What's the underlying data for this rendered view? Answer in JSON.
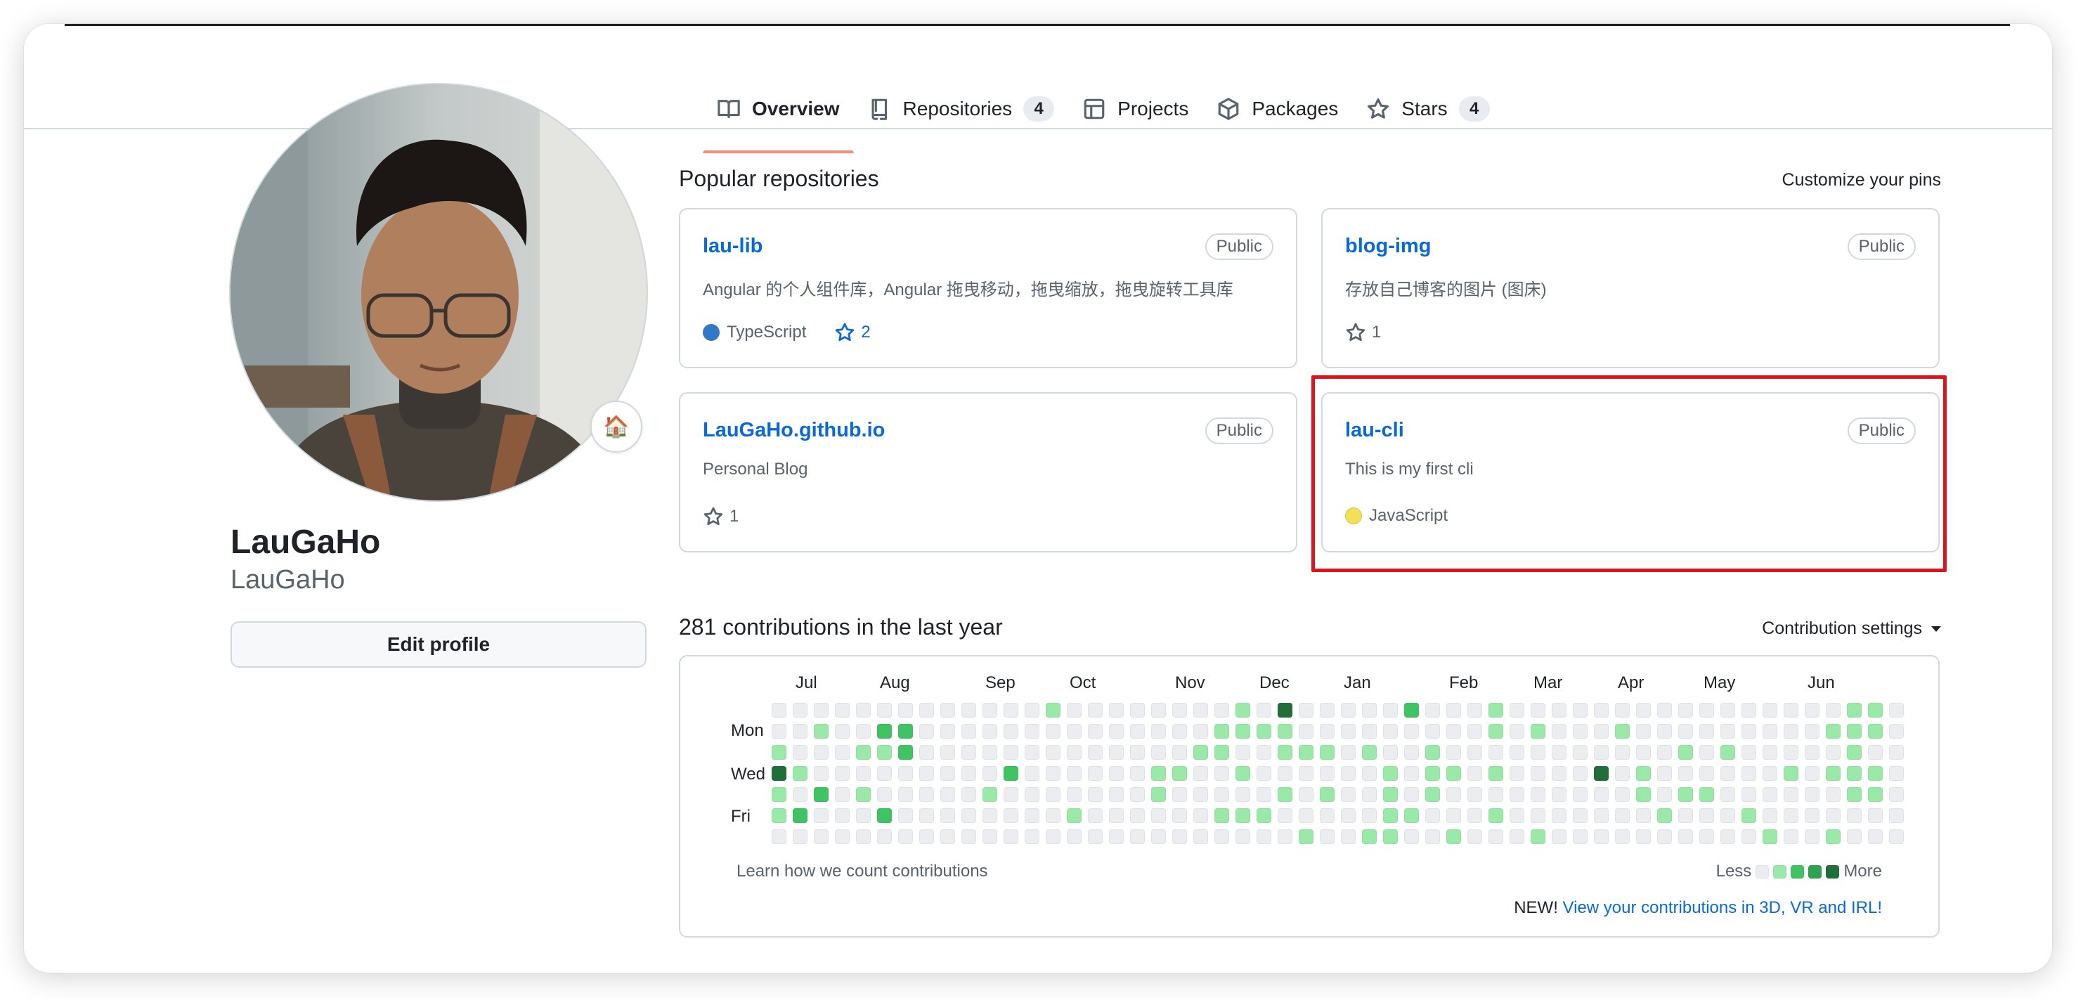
{
  "nav": {
    "tabs": [
      {
        "label": "Overview",
        "icon": "book-icon",
        "active": true
      },
      {
        "label": "Repositories",
        "icon": "repo-icon",
        "count": "4"
      },
      {
        "label": "Projects",
        "icon": "table-icon"
      },
      {
        "label": "Packages",
        "icon": "package-icon"
      },
      {
        "label": "Stars",
        "icon": "star-icon",
        "count": "4"
      }
    ]
  },
  "profile": {
    "name": "LauGaHo",
    "login": "LauGaHo",
    "status_emoji": "🏠",
    "edit_button": "Edit profile"
  },
  "pinned": {
    "title": "Popular repositories",
    "customize_link": "Customize your pins",
    "repos": [
      {
        "name": "lau-lib",
        "visibility": "Public",
        "description": "Angular 的个人组件库，Angular 拖曳移动，拖曳缩放，拖曳旋转工具库",
        "language": "TypeScript",
        "language_color": "#3178c6",
        "stars": "2"
      },
      {
        "name": "blog-img",
        "visibility": "Public",
        "description": "存放自己博客的图片 (图床)",
        "stars": "1"
      },
      {
        "name": "LauGaHo.github.io",
        "visibility": "Public",
        "description": "Personal Blog",
        "stars": "1"
      },
      {
        "name": "lau-cli",
        "visibility": "Public",
        "description": "This is my first cli",
        "language": "JavaScript",
        "language_color": "#f1e05a"
      }
    ]
  },
  "contributions": {
    "title": "281 contributions in the last year",
    "settings_label": "Contribution settings",
    "months": [
      "Jul",
      "Aug",
      "Sep",
      "Oct",
      "Nov",
      "Dec",
      "Jan",
      "Feb",
      "Mar",
      "Apr",
      "May",
      "Jun"
    ],
    "day_labels": [
      "Mon",
      "Wed",
      "Fri"
    ],
    "level_colors": [
      "#ebedf0",
      "#9be9a8",
      "#40c463",
      "#30a14e",
      "#216e39"
    ],
    "weeks": [
      [
        0,
        0,
        1,
        4,
        1,
        1,
        0
      ],
      [
        0,
        0,
        0,
        1,
        0,
        2,
        0
      ],
      [
        0,
        1,
        0,
        0,
        2,
        0,
        0
      ],
      [
        0,
        0,
        0,
        0,
        0,
        0,
        0
      ],
      [
        0,
        0,
        1,
        0,
        1,
        0,
        0
      ],
      [
        0,
        2,
        1,
        0,
        0,
        2,
        0
      ],
      [
        0,
        2,
        2,
        0,
        0,
        0,
        0
      ],
      [
        0,
        0,
        0,
        0,
        0,
        0,
        0
      ],
      [
        0,
        0,
        0,
        0,
        0,
        0,
        0
      ],
      [
        0,
        0,
        0,
        0,
        0,
        0,
        0
      ],
      [
        0,
        0,
        0,
        0,
        1,
        0,
        0
      ],
      [
        0,
        0,
        0,
        2,
        0,
        0,
        0
      ],
      [
        0,
        0,
        0,
        0,
        0,
        0,
        0
      ],
      [
        1,
        0,
        0,
        0,
        0,
        0,
        0
      ],
      [
        0,
        0,
        0,
        0,
        0,
        1,
        0
      ],
      [
        0,
        0,
        0,
        0,
        0,
        0,
        0
      ],
      [
        0,
        0,
        0,
        0,
        0,
        0,
        0
      ],
      [
        0,
        0,
        0,
        0,
        0,
        0,
        0
      ],
      [
        0,
        0,
        0,
        1,
        1,
        0,
        0
      ],
      [
        0,
        0,
        0,
        1,
        0,
        0,
        0
      ],
      [
        0,
        0,
        1,
        0,
        0,
        0,
        0
      ],
      [
        0,
        1,
        1,
        0,
        0,
        1,
        0
      ],
      [
        1,
        1,
        0,
        1,
        0,
        1,
        0
      ],
      [
        0,
        1,
        0,
        0,
        0,
        1,
        0
      ],
      [
        4,
        1,
        1,
        0,
        1,
        0,
        0
      ],
      [
        0,
        0,
        1,
        0,
        0,
        0,
        1
      ],
      [
        0,
        0,
        1,
        0,
        1,
        0,
        0
      ],
      [
        0,
        0,
        0,
        0,
        0,
        0,
        0
      ],
      [
        0,
        0,
        1,
        0,
        0,
        0,
        1
      ],
      [
        0,
        0,
        0,
        1,
        1,
        1,
        1
      ],
      [
        2,
        0,
        0,
        0,
        0,
        1,
        0
      ],
      [
        0,
        0,
        1,
        1,
        1,
        0,
        0
      ],
      [
        0,
        0,
        0,
        1,
        0,
        0,
        1
      ],
      [
        0,
        0,
        0,
        0,
        0,
        0,
        0
      ],
      [
        1,
        1,
        0,
        1,
        0,
        1,
        0
      ],
      [
        0,
        0,
        0,
        0,
        0,
        0,
        0
      ],
      [
        0,
        1,
        0,
        0,
        0,
        0,
        1
      ],
      [
        0,
        0,
        0,
        0,
        0,
        0,
        0
      ],
      [
        0,
        0,
        0,
        0,
        0,
        0,
        0
      ],
      [
        0,
        0,
        0,
        4,
        0,
        0,
        0
      ],
      [
        0,
        1,
        0,
        0,
        0,
        0,
        0
      ],
      [
        0,
        0,
        0,
        1,
        1,
        0,
        0
      ],
      [
        0,
        0,
        0,
        0,
        0,
        1,
        0
      ],
      [
        0,
        0,
        1,
        0,
        1,
        0,
        0
      ],
      [
        0,
        0,
        0,
        0,
        1,
        0,
        0
      ],
      [
        0,
        0,
        1,
        0,
        0,
        0,
        0
      ],
      [
        0,
        0,
        0,
        0,
        0,
        1,
        0
      ],
      [
        0,
        0,
        0,
        0,
        0,
        0,
        1
      ],
      [
        0,
        0,
        0,
        1,
        0,
        0,
        0
      ],
      [
        0,
        0,
        0,
        0,
        0,
        0,
        0
      ],
      [
        0,
        1,
        0,
        1,
        0,
        0,
        1
      ],
      [
        1,
        1,
        1,
        1,
        1,
        0,
        0
      ],
      [
        1,
        1,
        0,
        1,
        1,
        0,
        0
      ],
      [
        0,
        0,
        0,
        0,
        0,
        0,
        0
      ]
    ],
    "learn_link": "Learn how we count contributions",
    "legend_less": "Less",
    "legend_more": "More",
    "new_prefix": "NEW!",
    "new_link": "View your contributions in 3D, VR and IRL!"
  }
}
